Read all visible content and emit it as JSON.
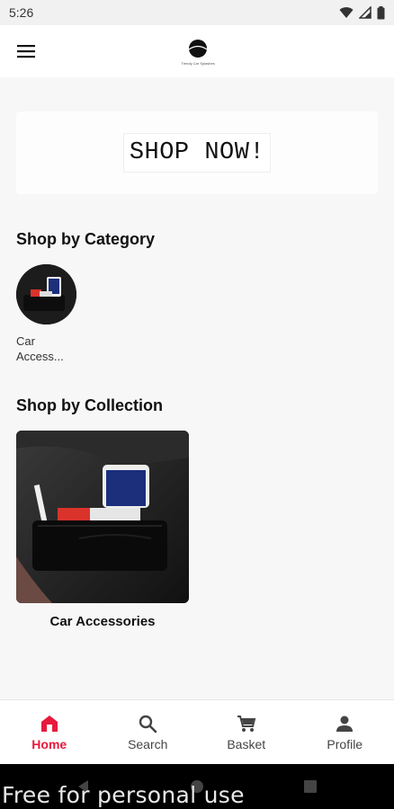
{
  "status_bar": {
    "time": "5:26"
  },
  "app_bar": {
    "logo_text": "Trendy Car Splashes"
  },
  "banner": {
    "label": "SHOP NOW!"
  },
  "categories": {
    "title": "Shop by Category",
    "items": [
      {
        "label": "Car Access..."
      }
    ]
  },
  "collections": {
    "title": "Shop by Collection",
    "items": [
      {
        "label": "Car Accessories"
      }
    ]
  },
  "bottom_nav": {
    "items": [
      {
        "label": "Home",
        "icon": "home-icon",
        "active": true
      },
      {
        "label": "Search",
        "icon": "search-icon",
        "active": false
      },
      {
        "label": "Basket",
        "icon": "cart-icon",
        "active": false
      },
      {
        "label": "Profile",
        "icon": "person-icon",
        "active": false
      }
    ]
  },
  "watermark": {
    "text": "Free for personal use"
  },
  "colors": {
    "accent": "#e8193c",
    "background": "#f7f7f7"
  }
}
